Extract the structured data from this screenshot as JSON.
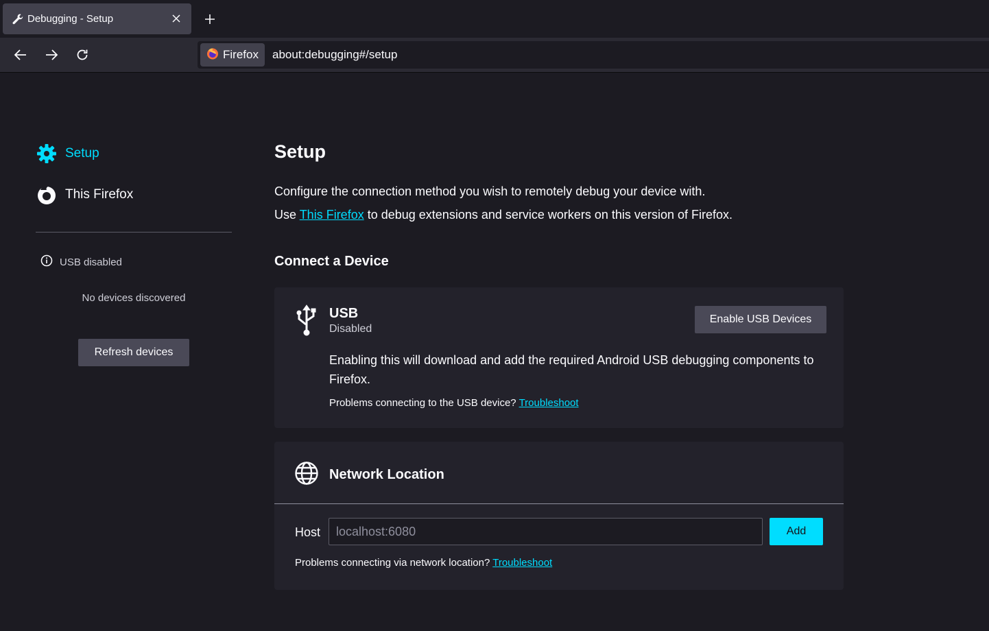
{
  "browser": {
    "tab": {
      "title": "Debugging - Setup",
      "icon": "wrench-icon"
    },
    "identity_label": "Firefox",
    "url": "about:debugging#/setup"
  },
  "sidebar": {
    "items": [
      {
        "label": "Setup",
        "icon": "gear-icon",
        "selected": true
      },
      {
        "label": "This Firefox",
        "icon": "firefox-logo-icon",
        "selected": false
      }
    ],
    "usb_status": "USB disabled",
    "no_devices": "No devices discovered",
    "refresh_label": "Refresh devices"
  },
  "main": {
    "title": "Setup",
    "intro_line1": "Configure the connection method you wish to remotely debug your device with.",
    "intro_line2_prefix": "Use ",
    "intro_line2_link": "This Firefox",
    "intro_line2_suffix": " to debug extensions and service workers on this version of Firefox.",
    "connect_title": "Connect a Device",
    "usb": {
      "title": "USB",
      "status": "Disabled",
      "button": "Enable USB Devices",
      "description": "Enabling this will download and add the required Android USB debugging components to Firefox.",
      "trouble_text": "Problems connecting to the USB device? ",
      "trouble_link": "Troubleshoot"
    },
    "network": {
      "title": "Network Location",
      "host_label": "Host",
      "host_placeholder": "localhost:6080",
      "host_value": "",
      "add_label": "Add",
      "trouble_text": "Problems connecting via network location? ",
      "trouble_link": "Troubleshoot"
    }
  },
  "colors": {
    "accent": "#00ddff",
    "background": "#1c1b22",
    "card": "#23222b",
    "button": "#4a4957"
  }
}
